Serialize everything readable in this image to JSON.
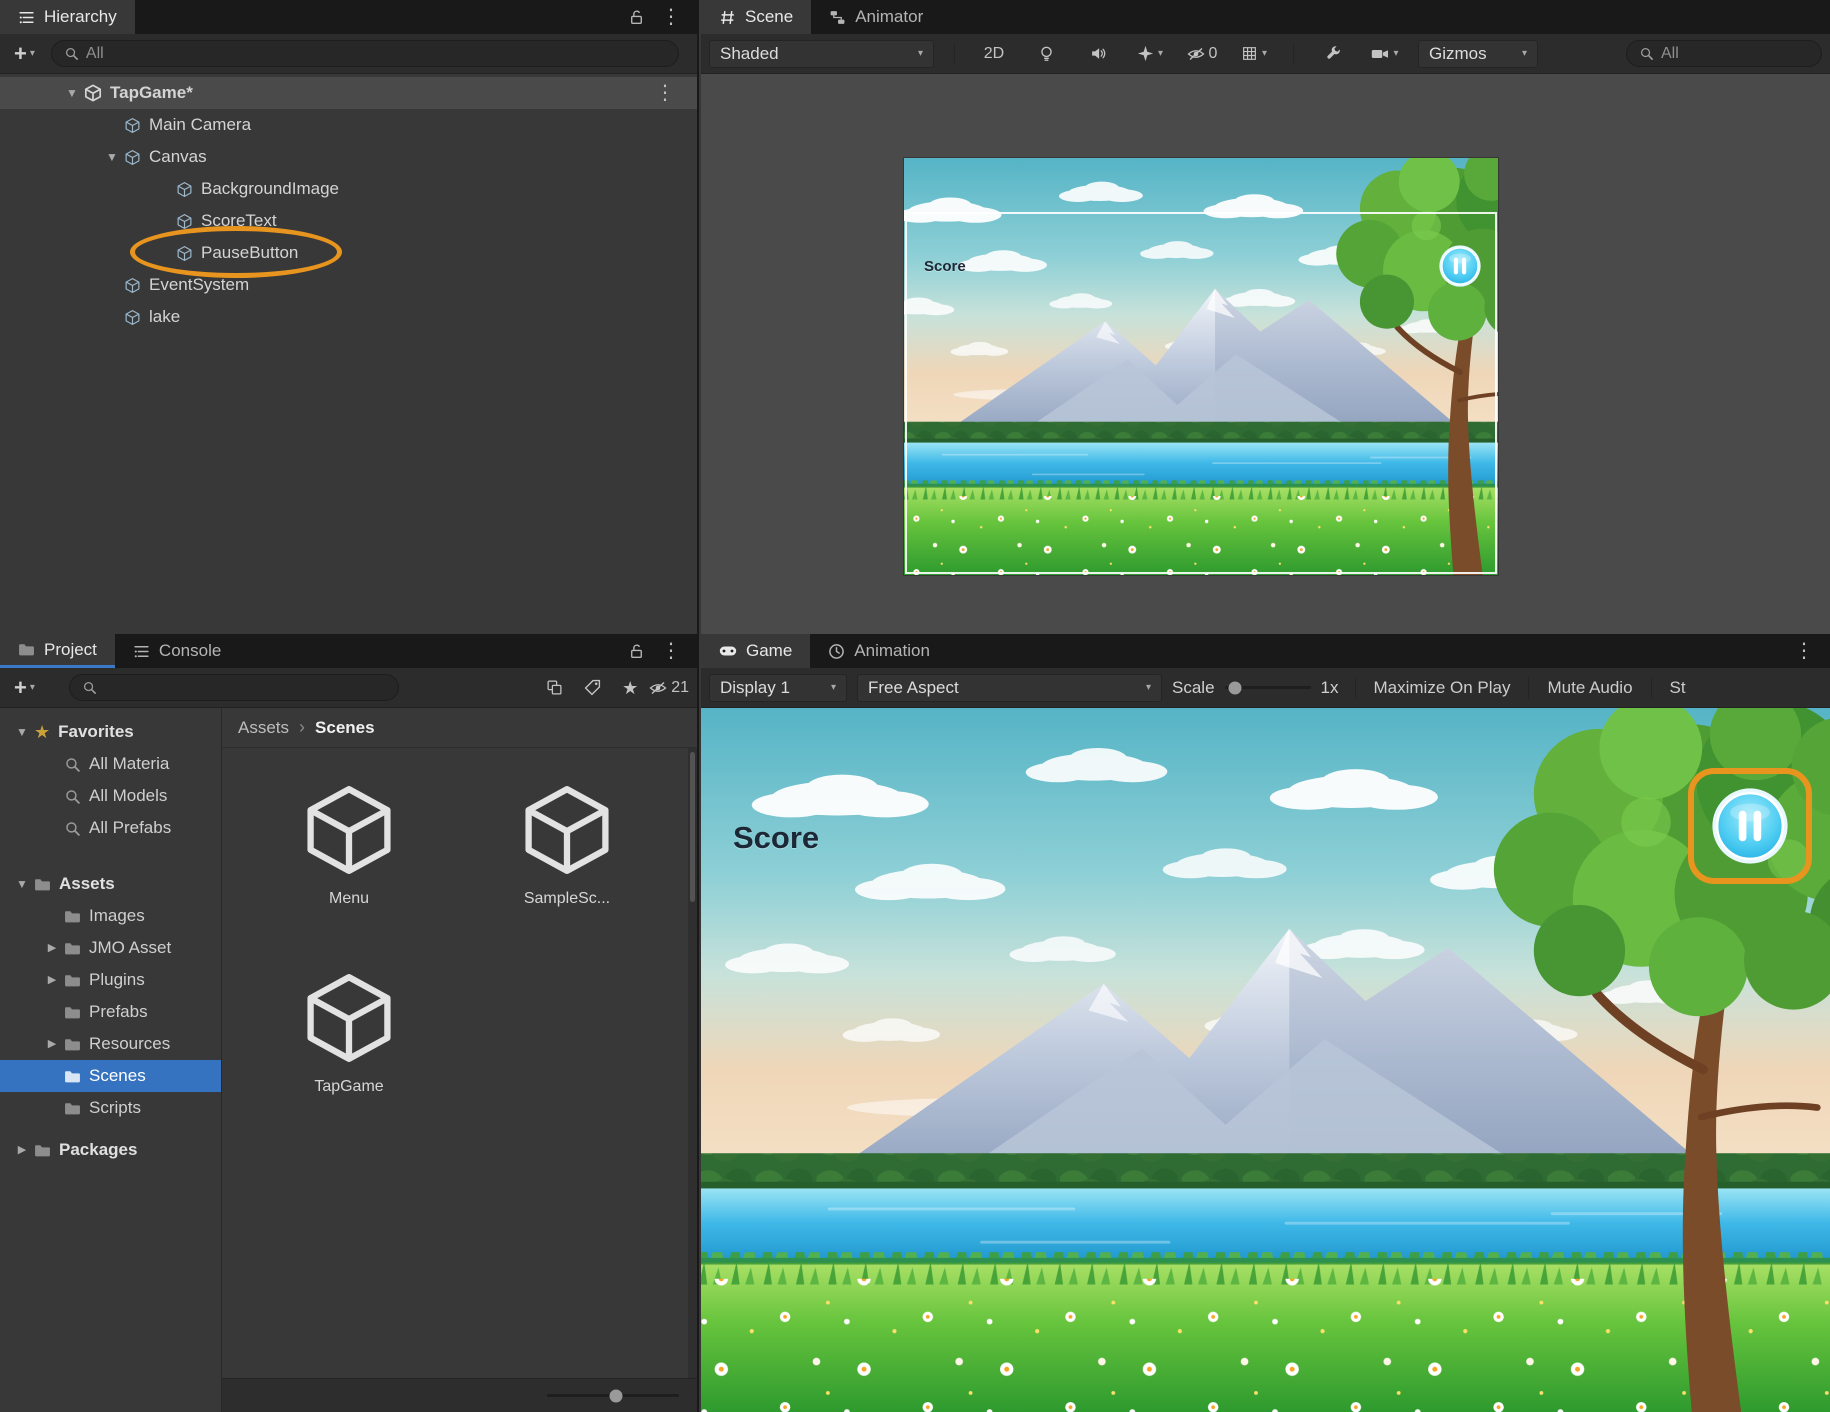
{
  "colors": {
    "accent_orange": "#E8951F",
    "selection_blue": "#3573C0"
  },
  "hierarchy": {
    "tab_label": "Hierarchy",
    "search_placeholder": "All",
    "root": {
      "label": "TapGame*"
    },
    "items": [
      {
        "label": "Main Camera"
      },
      {
        "label": "Canvas"
      },
      {
        "label": "BackgroundImage"
      },
      {
        "label": "ScoreText"
      },
      {
        "label": "PauseButton"
      },
      {
        "label": "EventSystem"
      },
      {
        "label": "lake"
      }
    ]
  },
  "scene_panel": {
    "tabs": {
      "scene": "Scene",
      "animator": "Animator"
    },
    "toolbar": {
      "shading_mode": "Shaded",
      "btn_2d": "2D",
      "hidden_count": "0",
      "gizmos_label": "Gizmos",
      "search_placeholder": "All"
    }
  },
  "game_panel": {
    "tabs": {
      "game": "Game",
      "animation": "Animation"
    },
    "toolbar": {
      "display": "Display 1",
      "aspect": "Free Aspect",
      "scale_label": "Scale",
      "scale_value": "1x",
      "maximize_label": "Maximize On Play",
      "mute_label": "Mute Audio",
      "stats_label": "St"
    }
  },
  "game_overlay": {
    "score_label": "Score"
  },
  "project_panel": {
    "tabs": {
      "project": "Project",
      "console": "Console"
    },
    "hidden_count": "21",
    "tree": {
      "favorites_label": "Favorites",
      "favorites": [
        "All Materia",
        "All Models",
        "All Prefabs"
      ],
      "assets_label": "Assets",
      "assets": [
        "Images",
        "JMO Asset",
        "Plugins",
        "Prefabs",
        "Resources",
        "Scenes",
        "Scripts"
      ],
      "packages_label": "Packages"
    },
    "breadcrumb": {
      "root": "Assets",
      "current": "Scenes"
    },
    "files": [
      {
        "name": "Menu"
      },
      {
        "name": "SampleSc..."
      },
      {
        "name": "TapGame"
      }
    ]
  }
}
